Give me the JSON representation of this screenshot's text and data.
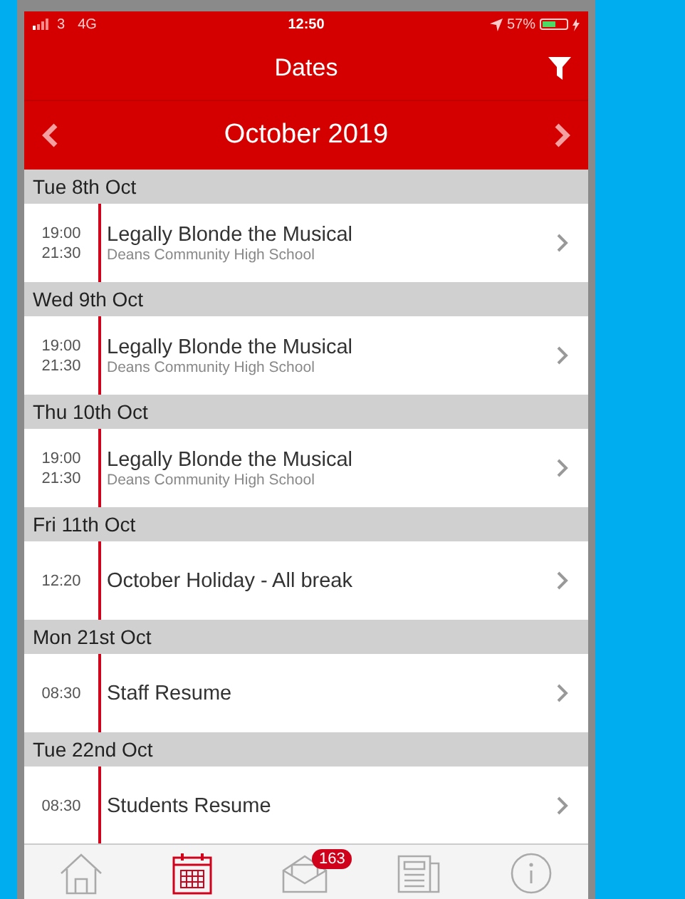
{
  "status_bar": {
    "carrier": "3",
    "network": "4G",
    "time": "12:50",
    "battery": "57%",
    "level": 0.57
  },
  "header": {
    "title": "Dates"
  },
  "month_nav": {
    "label": "October 2019"
  },
  "days": [
    {
      "date": "Tue 8th Oct",
      "events": [
        {
          "times": [
            "19:00",
            "21:30"
          ],
          "title": "Legally Blonde the Musical",
          "location": "Deans Community High School"
        }
      ]
    },
    {
      "date": "Wed 9th Oct",
      "events": [
        {
          "times": [
            "19:00",
            "21:30"
          ],
          "title": "Legally Blonde the Musical",
          "location": "Deans Community High School"
        }
      ]
    },
    {
      "date": "Thu 10th Oct",
      "events": [
        {
          "times": [
            "19:00",
            "21:30"
          ],
          "title": "Legally Blonde the Musical",
          "location": "Deans Community High School"
        }
      ]
    },
    {
      "date": "Fri 11th Oct",
      "events": [
        {
          "times": [
            "12:20"
          ],
          "title": "October Holiday - All break"
        }
      ]
    },
    {
      "date": "Mon 21st Oct",
      "events": [
        {
          "times": [
            "08:30"
          ],
          "title": "Staff Resume"
        }
      ]
    },
    {
      "date": "Tue 22nd Oct",
      "events": [
        {
          "times": [
            "08:30"
          ],
          "title": "Students Resume"
        }
      ]
    }
  ],
  "tab_bar": [
    {
      "kind": "home",
      "selected": false
    },
    {
      "kind": "calendar",
      "selected": true
    },
    {
      "kind": "mail",
      "selected": false,
      "badge": "163"
    },
    {
      "kind": "news",
      "selected": false
    },
    {
      "kind": "info",
      "selected": false
    }
  ]
}
